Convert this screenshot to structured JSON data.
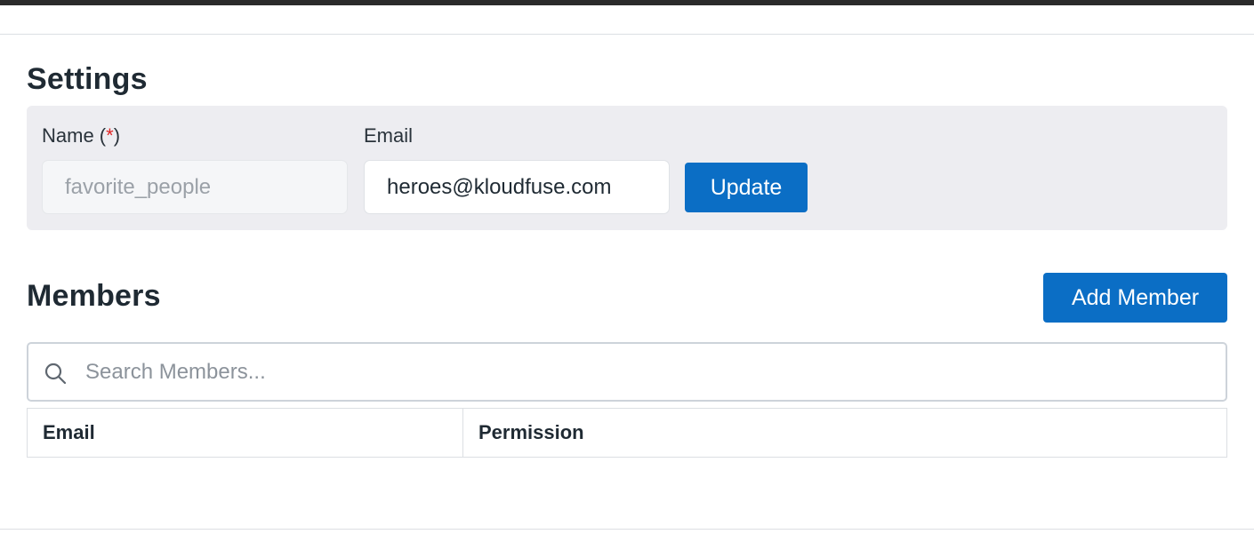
{
  "settings": {
    "title": "Settings",
    "name_label": "Name (",
    "name_required": "*",
    "name_label_end": ")",
    "name_value": "favorite_people",
    "email_label": "Email",
    "email_value": "heroes@kloudfuse.com",
    "update_label": "Update"
  },
  "members": {
    "title": "Members",
    "add_member_label": "Add Member",
    "search_placeholder": "Search Members...",
    "columns": [
      "Email",
      "Permission"
    ]
  },
  "colors": {
    "primary": "#0b6ec5",
    "required": "#e02424",
    "settings_bg": "#ededf1"
  },
  "icons": {
    "search": "search-icon"
  }
}
